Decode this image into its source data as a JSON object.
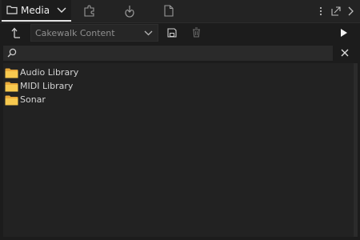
{
  "tabs": {
    "active_label": "Media",
    "icons": [
      "folder-icon",
      "plugin-puzzle-icon",
      "cloud-download-icon",
      "document-icon"
    ]
  },
  "window_controls": {
    "icons": [
      "more-vert-icon",
      "float-window-icon",
      "chevron-right-icon"
    ]
  },
  "toolbar": {
    "location_value": "Cakewalk Content",
    "icons": [
      "up-arrow-icon",
      "save-icon",
      "trash-icon",
      "play-icon"
    ]
  },
  "search": {
    "value": "",
    "icons": [
      "search-icon",
      "close-icon"
    ]
  },
  "browser": {
    "items": [
      {
        "label": "Audio Library",
        "icon": "folder-icon"
      },
      {
        "label": "MIDI Library",
        "icon": "folder-icon"
      },
      {
        "label": "Sonar",
        "icon": "folder-icon"
      }
    ]
  },
  "colors": {
    "background": "#1c1c1c",
    "folder": "#f2c14e",
    "active_tab_underline": "#e6e6e6"
  }
}
